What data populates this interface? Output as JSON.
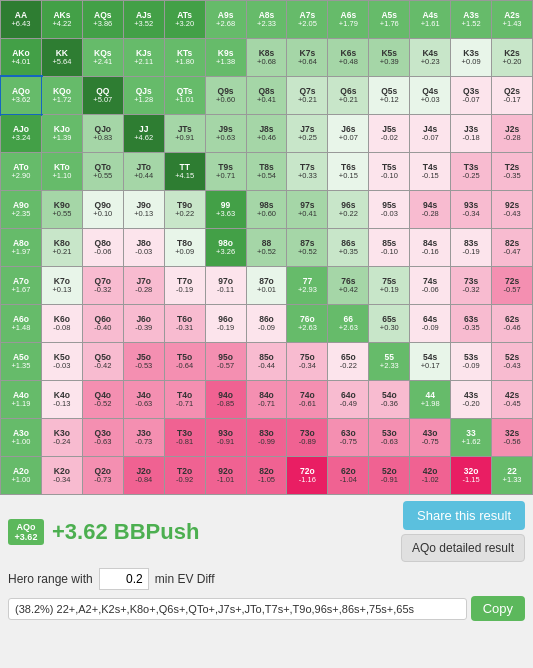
{
  "grid": {
    "cells": [
      {
        "hand": "AA",
        "ev": "+6.43",
        "color": "ev-vhigh"
      },
      {
        "hand": "AKs",
        "ev": "+4.22",
        "color": "ev-high"
      },
      {
        "hand": "AQs",
        "ev": "+3.86",
        "color": "ev-high"
      },
      {
        "hand": "AJs",
        "ev": "+3.52",
        "color": "ev-high"
      },
      {
        "hand": "ATs",
        "ev": "+3.20",
        "color": "ev-high"
      },
      {
        "hand": "A9s",
        "ev": "+2.68",
        "color": "ev-mhigh"
      },
      {
        "hand": "A8s",
        "ev": "+2.33",
        "color": "ev-mhigh"
      },
      {
        "hand": "A7s",
        "ev": "+2.05",
        "color": "ev-mhigh"
      },
      {
        "hand": "A6s",
        "ev": "+1.79",
        "color": "ev-mhigh"
      },
      {
        "hand": "A5s",
        "ev": "+1.76",
        "color": "ev-mhigh"
      },
      {
        "hand": "A4s",
        "ev": "+1.61",
        "color": "ev-mhigh"
      },
      {
        "hand": "A3s",
        "ev": "+1.52",
        "color": "ev-mhigh"
      },
      {
        "hand": "A2s",
        "ev": "+1.43",
        "color": "ev-mhigh"
      },
      {
        "hand": "AKo",
        "ev": "+4.01",
        "color": "ev-high"
      },
      {
        "hand": "KK",
        "ev": "+5.64",
        "color": "ev-vhigh"
      },
      {
        "hand": "KQs",
        "ev": "+2.41",
        "color": "ev-mhigh"
      },
      {
        "hand": "KJs",
        "ev": "+2.11",
        "color": "ev-mhigh"
      },
      {
        "hand": "KTs",
        "ev": "+1.80",
        "color": "ev-mhigh"
      },
      {
        "hand": "K9s",
        "ev": "+1.38",
        "color": "ev-mhigh"
      },
      {
        "hand": "K8s",
        "ev": "+0.68",
        "color": "ev-med"
      },
      {
        "hand": "K7s",
        "ev": "+0.64",
        "color": "ev-med"
      },
      {
        "hand": "K6s",
        "ev": "+0.48",
        "color": "ev-med"
      },
      {
        "hand": "K5s",
        "ev": "+0.39",
        "color": "ev-med"
      },
      {
        "hand": "K4s",
        "ev": "+0.23",
        "color": "ev-low"
      },
      {
        "hand": "K3s",
        "ev": "+0.09",
        "color": "ev-slight"
      },
      {
        "hand": "K2s",
        "ev": "+0.20",
        "color": "ev-low"
      },
      {
        "hand": "AQo",
        "ev": "+3.62",
        "color": "ev-selected"
      },
      {
        "hand": "KQo",
        "ev": "+1.72",
        "color": "ev-mhigh"
      },
      {
        "hand": "QQ",
        "ev": "+5.07",
        "color": "ev-vhigh"
      },
      {
        "hand": "QJs",
        "ev": "+1.28",
        "color": "ev-mhigh"
      },
      {
        "hand": "QTs",
        "ev": "+1.01",
        "color": "ev-mhigh"
      },
      {
        "hand": "Q9s",
        "ev": "+0.60",
        "color": "ev-med"
      },
      {
        "hand": "Q8s",
        "ev": "+0.41",
        "color": "ev-med"
      },
      {
        "hand": "Q7s",
        "ev": "+0.21",
        "color": "ev-low"
      },
      {
        "hand": "Q6s",
        "ev": "+0.21",
        "color": "ev-low"
      },
      {
        "hand": "Q5s",
        "ev": "+0.12",
        "color": "ev-slight"
      },
      {
        "hand": "Q4s",
        "ev": "+0.03",
        "color": "ev-slight"
      },
      {
        "hand": "Q3s",
        "ev": "-0.07",
        "color": "ev-neg-slight"
      },
      {
        "hand": "Q2s",
        "ev": "-0.17",
        "color": "ev-neg-slight"
      },
      {
        "hand": "AJo",
        "ev": "+3.24",
        "color": "ev-high"
      },
      {
        "hand": "KJo",
        "ev": "+1.39",
        "color": "ev-mhigh"
      },
      {
        "hand": "QJo",
        "ev": "+0.83",
        "color": "ev-med"
      },
      {
        "hand": "JJ",
        "ev": "+4.62",
        "color": "ev-vhigh"
      },
      {
        "hand": "JTs",
        "ev": "+0.91",
        "color": "ev-med"
      },
      {
        "hand": "J9s",
        "ev": "+0.63",
        "color": "ev-med"
      },
      {
        "hand": "J8s",
        "ev": "+0.46",
        "color": "ev-med"
      },
      {
        "hand": "J7s",
        "ev": "+0.25",
        "color": "ev-low"
      },
      {
        "hand": "J6s",
        "ev": "+0.07",
        "color": "ev-slight"
      },
      {
        "hand": "J5s",
        "ev": "-0.02",
        "color": "ev-neg-slight"
      },
      {
        "hand": "J4s",
        "ev": "-0.07",
        "color": "ev-neg-slight"
      },
      {
        "hand": "J3s",
        "ev": "-0.18",
        "color": "ev-neg-slight"
      },
      {
        "hand": "J2s",
        "ev": "-0.28",
        "color": "ev-neg-low"
      },
      {
        "hand": "ATo",
        "ev": "+2.90",
        "color": "ev-mhigh"
      },
      {
        "hand": "KTo",
        "ev": "+1.10",
        "color": "ev-mhigh"
      },
      {
        "hand": "QTo",
        "ev": "+0.55",
        "color": "ev-med"
      },
      {
        "hand": "JTo",
        "ev": "+0.44",
        "color": "ev-med"
      },
      {
        "hand": "TT",
        "ev": "+4.15",
        "color": "ev-vhigh"
      },
      {
        "hand": "T9s",
        "ev": "+0.71",
        "color": "ev-med"
      },
      {
        "hand": "T8s",
        "ev": "+0.54",
        "color": "ev-med"
      },
      {
        "hand": "T7s",
        "ev": "+0.33",
        "color": "ev-low"
      },
      {
        "hand": "T6s",
        "ev": "+0.15",
        "color": "ev-slight"
      },
      {
        "hand": "T5s",
        "ev": "-0.10",
        "color": "ev-neg-slight"
      },
      {
        "hand": "T4s",
        "ev": "-0.15",
        "color": "ev-neg-slight"
      },
      {
        "hand": "T3s",
        "ev": "-0.25",
        "color": "ev-neg-low"
      },
      {
        "hand": "T2s",
        "ev": "-0.35",
        "color": "ev-neg-low"
      },
      {
        "hand": "A9o",
        "ev": "+2.35",
        "color": "ev-mhigh"
      },
      {
        "hand": "K9o",
        "ev": "+0.55",
        "color": "ev-med"
      },
      {
        "hand": "Q9o",
        "ev": "+0.10",
        "color": "ev-slight"
      },
      {
        "hand": "J9o",
        "ev": "+0.13",
        "color": "ev-slight"
      },
      {
        "hand": "T9o",
        "ev": "+0.22",
        "color": "ev-low"
      },
      {
        "hand": "99",
        "ev": "+3.63",
        "color": "ev-high"
      },
      {
        "hand": "98s",
        "ev": "+0.60",
        "color": "ev-med"
      },
      {
        "hand": "97s",
        "ev": "+0.41",
        "color": "ev-med"
      },
      {
        "hand": "96s",
        "ev": "+0.22",
        "color": "ev-low"
      },
      {
        "hand": "95s",
        "ev": "-0.03",
        "color": "ev-neg-slight"
      },
      {
        "hand": "94s",
        "ev": "-0.28",
        "color": "ev-neg-low"
      },
      {
        "hand": "93s",
        "ev": "-0.34",
        "color": "ev-neg-low"
      },
      {
        "hand": "92s",
        "ev": "-0.43",
        "color": "ev-neg-low"
      },
      {
        "hand": "A8o",
        "ev": "+1.97",
        "color": "ev-mhigh"
      },
      {
        "hand": "K8o",
        "ev": "+0.21",
        "color": "ev-low"
      },
      {
        "hand": "Q8o",
        "ev": "-0.06",
        "color": "ev-neg-slight"
      },
      {
        "hand": "J8o",
        "ev": "-0.03",
        "color": "ev-neg-slight"
      },
      {
        "hand": "T8o",
        "ev": "+0.09",
        "color": "ev-slight"
      },
      {
        "hand": "98o",
        "ev": "+3.26",
        "color": "ev-high"
      },
      {
        "hand": "88",
        "ev": "+0.52",
        "color": "ev-med"
      },
      {
        "hand": "87s",
        "ev": "+0.52",
        "color": "ev-med"
      },
      {
        "hand": "86s",
        "ev": "+0.35",
        "color": "ev-low"
      },
      {
        "hand": "85s",
        "ev": "-0.10",
        "color": "ev-neg-slight"
      },
      {
        "hand": "84s",
        "ev": "-0.16",
        "color": "ev-neg-slight"
      },
      {
        "hand": "83s",
        "ev": "-0.19",
        "color": "ev-neg-slight"
      },
      {
        "hand": "82s",
        "ev": "-0.47",
        "color": "ev-neg-low"
      },
      {
        "hand": "A7o",
        "ev": "+1.67",
        "color": "ev-mhigh"
      },
      {
        "hand": "K7o",
        "ev": "+0.13",
        "color": "ev-slight"
      },
      {
        "hand": "Q7o",
        "ev": "-0.32",
        "color": "ev-neg-low"
      },
      {
        "hand": "J7o",
        "ev": "-0.28",
        "color": "ev-neg-low"
      },
      {
        "hand": "T7o",
        "ev": "-0.19",
        "color": "ev-neg-slight"
      },
      {
        "hand": "97o",
        "ev": "-0.11",
        "color": "ev-neg-slight"
      },
      {
        "hand": "87o",
        "ev": "+0.01",
        "color": "ev-slight"
      },
      {
        "hand": "77",
        "ev": "+2.93",
        "color": "ev-mhigh"
      },
      {
        "hand": "76s",
        "ev": "+0.42",
        "color": "ev-med"
      },
      {
        "hand": "75s",
        "ev": "+0.19",
        "color": "ev-low"
      },
      {
        "hand": "74s",
        "ev": "-0.06",
        "color": "ev-neg-slight"
      },
      {
        "hand": "73s",
        "ev": "-0.32",
        "color": "ev-neg-low"
      },
      {
        "hand": "72s",
        "ev": "-0.57",
        "color": "ev-neg-med"
      },
      {
        "hand": "A6o",
        "ev": "+1.48",
        "color": "ev-mhigh"
      },
      {
        "hand": "K6o",
        "ev": "-0.08",
        "color": "ev-neg-slight"
      },
      {
        "hand": "Q6o",
        "ev": "-0.40",
        "color": "ev-neg-low"
      },
      {
        "hand": "J6o",
        "ev": "-0.39",
        "color": "ev-neg-low"
      },
      {
        "hand": "T6o",
        "ev": "-0.31",
        "color": "ev-neg-low"
      },
      {
        "hand": "96o",
        "ev": "-0.19",
        "color": "ev-neg-slight"
      },
      {
        "hand": "86o",
        "ev": "-0.09",
        "color": "ev-neg-slight"
      },
      {
        "hand": "76o",
        "ev": "+2.63",
        "color": "ev-mhigh"
      },
      {
        "hand": "66",
        "ev": "+2.63",
        "color": "ev-mhigh"
      },
      {
        "hand": "65s",
        "ev": "+0.30",
        "color": "ev-low"
      },
      {
        "hand": "64s",
        "ev": "-0.09",
        "color": "ev-neg-slight"
      },
      {
        "hand": "63s",
        "ev": "-0.35",
        "color": "ev-neg-low"
      },
      {
        "hand": "62s",
        "ev": "-0.46",
        "color": "ev-neg-low"
      },
      {
        "hand": "A5o",
        "ev": "+1.35",
        "color": "ev-mhigh"
      },
      {
        "hand": "K5o",
        "ev": "-0.03",
        "color": "ev-neg-slight"
      },
      {
        "hand": "Q5o",
        "ev": "-0.42",
        "color": "ev-neg-low"
      },
      {
        "hand": "J5o",
        "ev": "-0.53",
        "color": "ev-neg-med"
      },
      {
        "hand": "T5o",
        "ev": "-0.64",
        "color": "ev-neg-med"
      },
      {
        "hand": "95o",
        "ev": "-0.57",
        "color": "ev-neg-med"
      },
      {
        "hand": "85o",
        "ev": "-0.44",
        "color": "ev-neg-low"
      },
      {
        "hand": "75o",
        "ev": "-0.34",
        "color": "ev-neg-low"
      },
      {
        "hand": "65o",
        "ev": "-0.22",
        "color": "ev-neg-slight"
      },
      {
        "hand": "55",
        "ev": "+2.33",
        "color": "ev-mhigh"
      },
      {
        "hand": "54s",
        "ev": "+0.17",
        "color": "ev-slight"
      },
      {
        "hand": "53s",
        "ev": "-0.09",
        "color": "ev-neg-slight"
      },
      {
        "hand": "52s",
        "ev": "-0.43",
        "color": "ev-neg-low"
      },
      {
        "hand": "A4o",
        "ev": "+1.19",
        "color": "ev-mhigh"
      },
      {
        "hand": "K4o",
        "ev": "-0.13",
        "color": "ev-neg-slight"
      },
      {
        "hand": "Q4o",
        "ev": "-0.52",
        "color": "ev-neg-med"
      },
      {
        "hand": "J4o",
        "ev": "-0.63",
        "color": "ev-neg-med"
      },
      {
        "hand": "T4o",
        "ev": "-0.71",
        "color": "ev-neg-med"
      },
      {
        "hand": "94o",
        "ev": "-0.85",
        "color": "ev-neg-high"
      },
      {
        "hand": "84o",
        "ev": "-0.71",
        "color": "ev-neg-med"
      },
      {
        "hand": "74o",
        "ev": "-0.61",
        "color": "ev-neg-med"
      },
      {
        "hand": "64o",
        "ev": "-0.49",
        "color": "ev-neg-low"
      },
      {
        "hand": "54o",
        "ev": "-0.36",
        "color": "ev-neg-low"
      },
      {
        "hand": "44",
        "ev": "+1.98",
        "color": "ev-mhigh"
      },
      {
        "hand": "43s",
        "ev": "-0.20",
        "color": "ev-neg-slight"
      },
      {
        "hand": "42s",
        "ev": "-0.45",
        "color": "ev-neg-low"
      },
      {
        "hand": "A3o",
        "ev": "+1.00",
        "color": "ev-mhigh"
      },
      {
        "hand": "K3o",
        "ev": "-0.24",
        "color": "ev-neg-low"
      },
      {
        "hand": "Q3o",
        "ev": "-0.63",
        "color": "ev-neg-med"
      },
      {
        "hand": "J3o",
        "ev": "-0.73",
        "color": "ev-neg-med"
      },
      {
        "hand": "T3o",
        "ev": "-0.81",
        "color": "ev-neg-high"
      },
      {
        "hand": "93o",
        "ev": "-0.91",
        "color": "ev-neg-high"
      },
      {
        "hand": "83o",
        "ev": "-0.99",
        "color": "ev-neg-high"
      },
      {
        "hand": "73o",
        "ev": "-0.89",
        "color": "ev-neg-high"
      },
      {
        "hand": "63o",
        "ev": "-0.75",
        "color": "ev-neg-med"
      },
      {
        "hand": "53o",
        "ev": "-0.63",
        "color": "ev-neg-med"
      },
      {
        "hand": "43o",
        "ev": "-0.75",
        "color": "ev-neg-med"
      },
      {
        "hand": "33",
        "ev": "+1.62",
        "color": "ev-mhigh"
      },
      {
        "hand": "32s",
        "ev": "-0.56",
        "color": "ev-neg-med"
      },
      {
        "hand": "A2o",
        "ev": "+1.00",
        "color": "ev-mhigh"
      },
      {
        "hand": "K2o",
        "ev": "-0.34",
        "color": "ev-neg-low"
      },
      {
        "hand": "Q2o",
        "ev": "-0.73",
        "color": "ev-neg-med"
      },
      {
        "hand": "J2o",
        "ev": "-0.84",
        "color": "ev-neg-high"
      },
      {
        "hand": "T2o",
        "ev": "-0.92",
        "color": "ev-neg-high"
      },
      {
        "hand": "92o",
        "ev": "-1.01",
        "color": "ev-neg-high"
      },
      {
        "hand": "82o",
        "ev": "-1.05",
        "color": "ev-neg-high"
      },
      {
        "hand": "72o",
        "ev": "-1.16",
        "color": "ev-neg-vhigh"
      },
      {
        "hand": "62o",
        "ev": "-1.04",
        "color": "ev-neg-high"
      },
      {
        "hand": "52o",
        "ev": "-0.91",
        "color": "ev-neg-high"
      },
      {
        "hand": "42o",
        "ev": "-1.02",
        "color": "ev-neg-high"
      },
      {
        "hand": "32o",
        "ev": "-1.15",
        "color": "ev-neg-vhigh"
      },
      {
        "hand": "22",
        "ev": "+1.33",
        "color": "ev-mhigh"
      }
    ]
  },
  "result": {
    "badge_hand": "AQo",
    "badge_ev": "+3.62",
    "label": "+3.62 BBPush",
    "share_button": "Share this result",
    "detail_button": "AQo detailed result"
  },
  "hero": {
    "label": "Hero range with",
    "value": "0.2",
    "suffix": "min EV Diff"
  },
  "range": {
    "text": "(38.2%) 22+,A2+,K2s+,K8o+,Q6s+,QTo+,J7s+,JTo,T7s+,T9o,96s+,86s+,75s+,65s",
    "copy_label": "Copy"
  }
}
